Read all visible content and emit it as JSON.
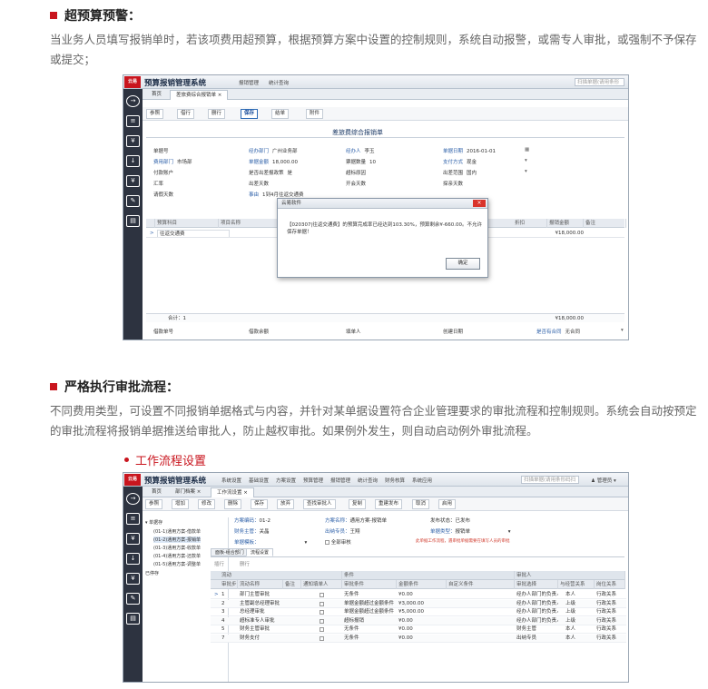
{
  "section1": {
    "title": "超预算预警：",
    "text": "当业务人员填写报销单时，若该项费用超预算，根据预算方案中设置的控制规则，系统自动报警，或需专人审批，或强制不予保存或提交；"
  },
  "section2": {
    "title": "严格执行审批流程：",
    "text": "不同费用类型，可设置不同报销单据格式与内容，并针对某单据设置符合企业管理要求的审批流程和控制规则。系统会自动按预定的审批流程将报销单据推送给审批人，防止越权审批。如果例外发生，则自动启动例外审批流程。",
    "subtitle": "工作流程设置"
  },
  "shot1": {
    "logo": "云易",
    "app_name": "预算报销管理系统",
    "menu": [
      "报销管理",
      "统计查询"
    ],
    "search_placeholder": "扫描单据(请用条形码扫描枪扫描)",
    "tabs": [
      "首页",
      "差旅费综合报销单 ×"
    ],
    "toolbar": [
      "参照",
      "借行",
      "删行",
      "保存",
      "结单",
      "附件"
    ],
    "form_title": "差旅费综合报销单",
    "fields": [
      {
        "label": "单据号",
        "value": ""
      },
      {
        "label": "经办部门",
        "value": "广州业务部"
      },
      {
        "label": "经办人",
        "value": "李玉"
      },
      {
        "label": "单据日期",
        "value": "2016-01-01"
      },
      {
        "label": "费用部门",
        "value": "市场部"
      },
      {
        "label": "单据金额",
        "value": "18,000.00"
      },
      {
        "label": "票据数量",
        "value": "10"
      },
      {
        "label": "支付方式",
        "value": "现金"
      },
      {
        "label": "付款账户",
        "value": ""
      },
      {
        "label": "是否出差报政策",
        "value": "是"
      },
      {
        "label": "超标原因",
        "value": ""
      },
      {
        "label": "出差范围",
        "value": "国内"
      },
      {
        "label": "汇率",
        "value": ""
      },
      {
        "label": "出差天数",
        "value": ""
      },
      {
        "label": "开会天数",
        "value": ""
      },
      {
        "label": "探亲天数",
        "value": ""
      },
      {
        "label": "请假天数",
        "value": ""
      },
      {
        "label": "事由",
        "value": "1到4月往返交通费"
      }
    ],
    "grid_headers": [
      "预算科目",
      "项目名称",
      "折扣",
      "报销金额",
      "备注"
    ],
    "grid_row": {
      "subject": "往返交通费",
      "amount": "¥18,000.00"
    },
    "total_label": "合计：1",
    "total_amount": "¥18,000.00",
    "bottom_fields": [
      "借款单号",
      "借款余额",
      "填单人",
      "创建日期",
      "是否有合同",
      "无合同"
    ],
    "dialog": {
      "title": "云易软件",
      "message": "【020307|往返交通费】的预算完成率已经达到103.30%，预算剩余¥-660.00。不允许保存单据！",
      "ok": "确定",
      "close": "×"
    }
  },
  "shot2": {
    "logo": "云易",
    "app_name": "预算报销管理系统",
    "menu": [
      "系统设置",
      "基础设置",
      "方案设置",
      "预算管理",
      "报销管理",
      "统计查询",
      "财务核算",
      "系统应用"
    ],
    "search_placeholder": "扫描单据(请用条形码扫描枪扫描)",
    "user": "管理员",
    "tabs": [
      "首页",
      "部门档案 ×",
      "工作流设置 ×"
    ],
    "toolbar": [
      "参照",
      "增加",
      "修改",
      "删除",
      "保存",
      "放弃",
      "查找审批人",
      "复制",
      "重建发布",
      "取消",
      "启用"
    ],
    "tree_root": "单据存",
    "tree_items": [
      "(01-1)通用方案-借款单",
      "(01-2)通用方案-报销单",
      "(01-3)通用方案-收款单",
      "(01-4)通用方案-还款单",
      "(01-5)通用方案-调整单"
    ],
    "tree_other": "已停存",
    "info": [
      {
        "label": "方案编码：",
        "value": "01-2"
      },
      {
        "label": "方案名称：",
        "value": "通用方案-报销单"
      },
      {
        "label": "发布状态：",
        "value": "已发布"
      },
      {
        "label": "财务主管：",
        "value": "关晶"
      },
      {
        "label": "出纳专员：",
        "value": "王翔"
      },
      {
        "label": "单据类型：",
        "value": "报销单"
      },
      {
        "label": "单据模板：",
        "value": ""
      },
      {
        "label": "全部审核",
        "value": ""
      }
    ],
    "note": "此单据工作流程，遇审批单据需要在填写人员的审批",
    "subtabs": [
      "面板-组合部门",
      "流程设置"
    ],
    "subtoolbar": [
      "插行",
      "删行"
    ],
    "group_headers": [
      "流动",
      "条件",
      "审批人"
    ],
    "headers": [
      "审批步",
      "流动名称",
      "备注",
      "通知填单人",
      "审批条件",
      "金额条件",
      "自定义条件",
      "审批选择",
      "与经营关系",
      "岗位关系"
    ],
    "rows": [
      {
        "no": "1",
        "name": "部门主管审批",
        "cond": "无条件",
        "amount": "¥0.00",
        "sel": "经办人部门的负责人",
        "rel": "本人",
        "post": "行政关系"
      },
      {
        "no": "2",
        "name": "主管副总经理审批",
        "cond": "单据金额超过金额条件",
        "amount": "¥3,000.00",
        "sel": "经办人部门的负责人",
        "rel": "上级",
        "post": "行政关系"
      },
      {
        "no": "3",
        "name": "总经理审批",
        "cond": "单据金额超过金额条件",
        "amount": "¥5,000.00",
        "sel": "经办人部门的负责人",
        "rel": "上级",
        "post": "行政关系"
      },
      {
        "no": "4",
        "name": "超标准专人审批",
        "cond": "超标报销",
        "amount": "¥0.00",
        "sel": "经办人部门的负责人",
        "rel": "上级",
        "post": "行政关系"
      },
      {
        "no": "5",
        "name": "财务主管审批",
        "cond": "无条件",
        "amount": "¥0.00",
        "sel": "财务主管",
        "rel": "本人",
        "post": "行政关系"
      },
      {
        "no": "7",
        "name": "财务支付",
        "cond": "无条件",
        "amount": "¥0.00",
        "sel": "出纳专员",
        "rel": "本人",
        "post": "行政关系"
      }
    ]
  }
}
